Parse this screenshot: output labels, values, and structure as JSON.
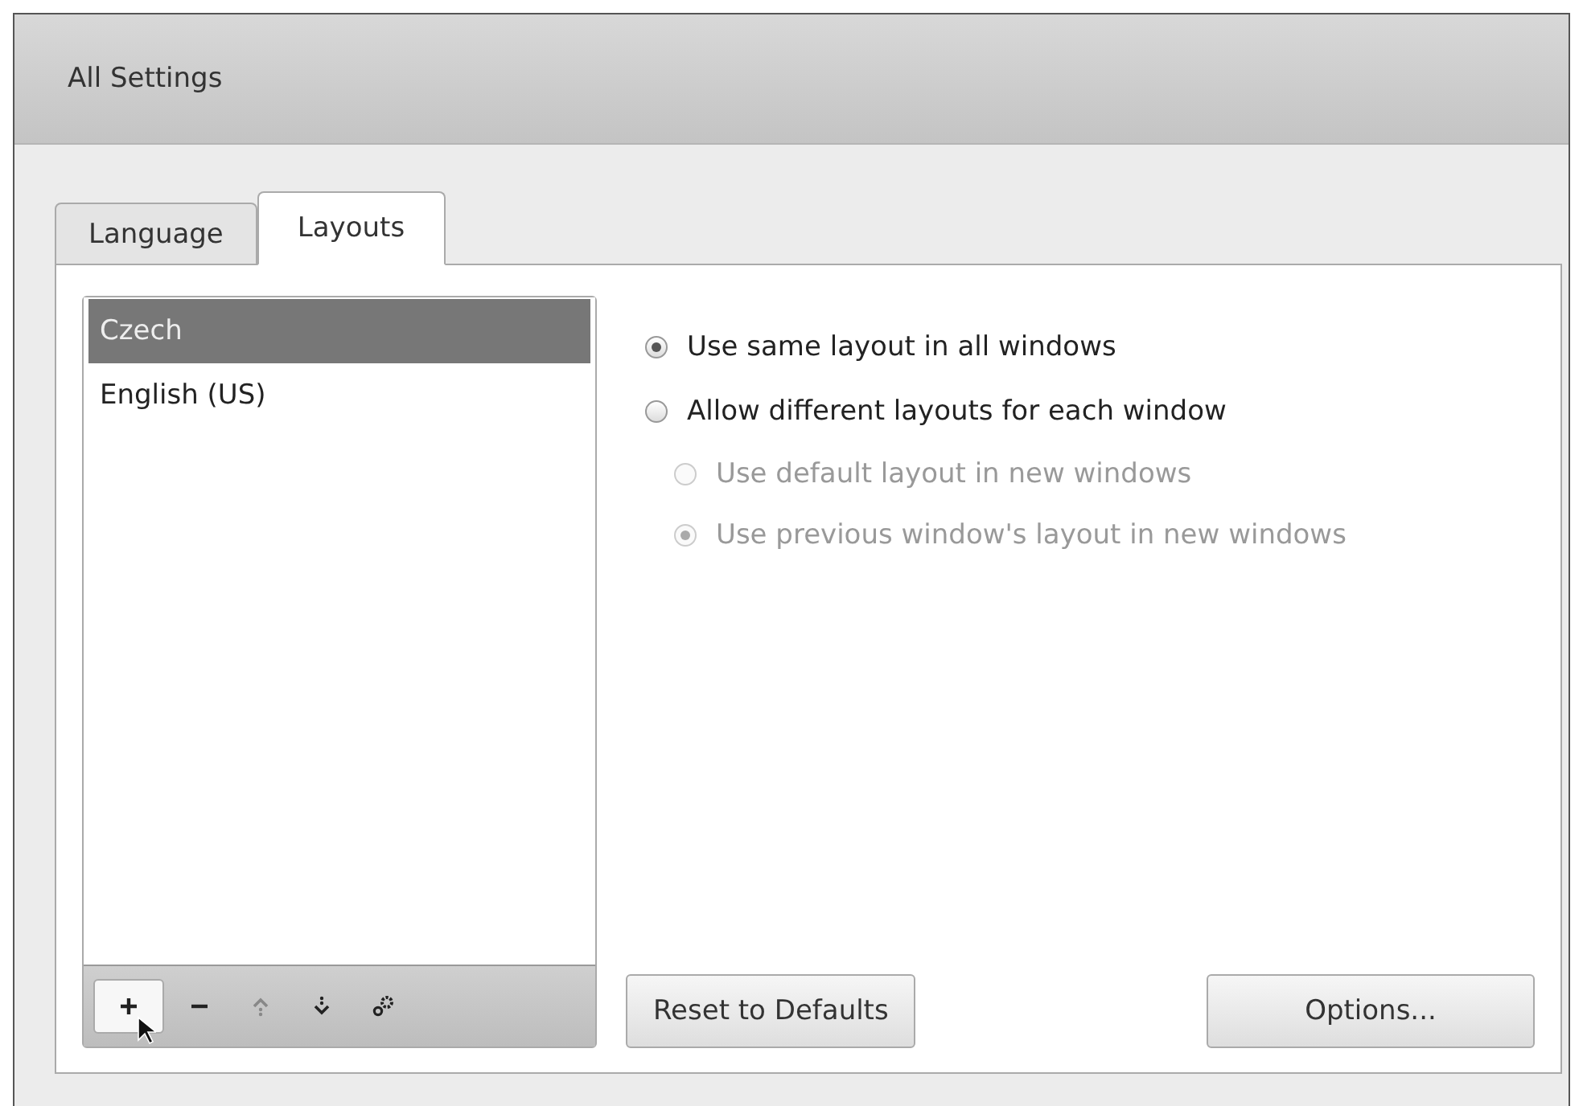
{
  "window": {
    "title": "All Settings"
  },
  "tabs": [
    {
      "label": "Language",
      "selected": false
    },
    {
      "label": "Layouts",
      "selected": true
    }
  ],
  "layouts": [
    {
      "label": "Czech",
      "selected": true
    },
    {
      "label": "English (US)",
      "selected": false
    }
  ],
  "toolbar": [
    {
      "kind": "add",
      "pressed": true,
      "disabled": false
    },
    {
      "kind": "remove",
      "pressed": false,
      "disabled": false
    },
    {
      "kind": "up",
      "pressed": false,
      "disabled": true
    },
    {
      "kind": "down",
      "pressed": false,
      "disabled": false
    },
    {
      "kind": "settings",
      "pressed": false,
      "disabled": false
    }
  ],
  "options": [
    {
      "label": "Use same layout in all windows",
      "selected": true,
      "disabled": false
    },
    {
      "label": "Allow different layouts for each window",
      "selected": false,
      "disabled": false,
      "children": [
        {
          "label": "Use default layout in new windows",
          "selected": false,
          "disabled": true
        },
        {
          "label": "Use previous window's layout in new windows",
          "selected": true,
          "disabled": true
        }
      ]
    }
  ],
  "buttons": [
    "Reset to Defaults",
    "Options..."
  ]
}
